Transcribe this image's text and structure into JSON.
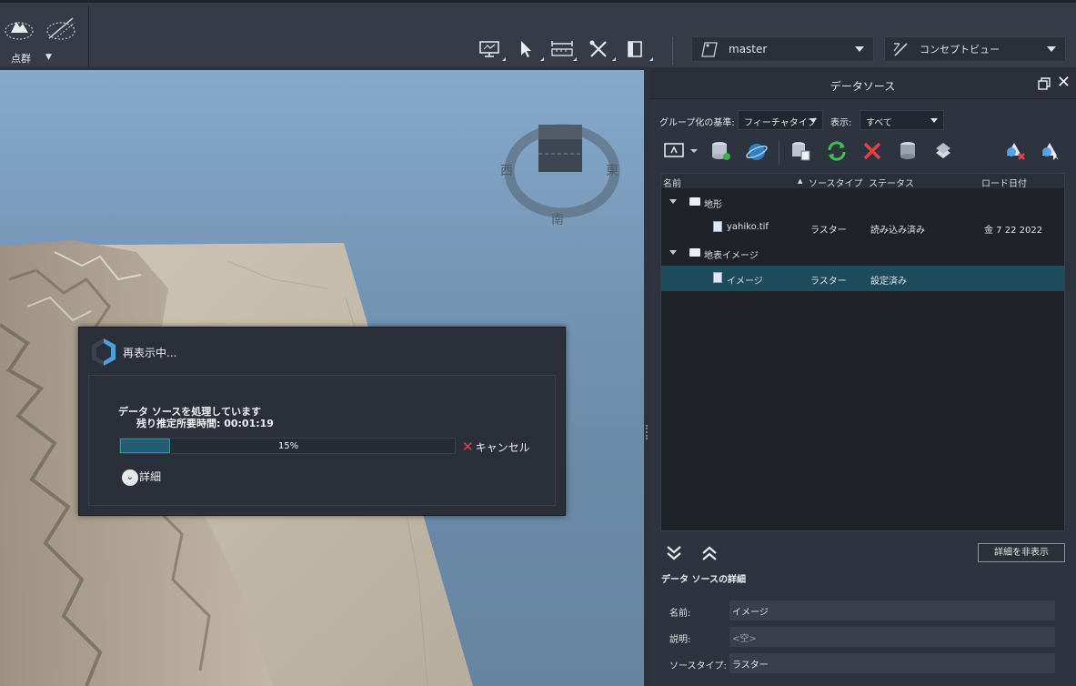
{
  "toolbar": {
    "group_label": "点群",
    "branch": "master",
    "view": "コンセプトビュー"
  },
  "compass": {
    "west": "西",
    "east": "東",
    "south": "南"
  },
  "panel": {
    "title": "データソース",
    "group_by_label": "グループ化の基準:",
    "group_by_value": "フィーチャタイプ",
    "display_label": "表示:",
    "display_value": "すべて",
    "columns": [
      "名前",
      "ソースタイプ",
      "ステータス",
      "ロード日付"
    ],
    "rows": [
      {
        "type": "folder",
        "name": "地形"
      },
      {
        "type": "file",
        "name": "yahiko.tif",
        "source": "ラスター",
        "status": "読み込み済み",
        "date": "金 7 22 2022"
      },
      {
        "type": "folder",
        "name": "地表イメージ"
      },
      {
        "type": "file",
        "name": "イメージ",
        "source": "ラスター",
        "status": "設定済み",
        "date": "",
        "selected": true
      }
    ],
    "hide_details": "詳細を非表示",
    "details_title": "データ ソースの詳細",
    "details": [
      {
        "label": "名前:",
        "value": "イメージ"
      },
      {
        "label": "説明:",
        "value": "<空>"
      },
      {
        "label": "ソースタイプ:",
        "value": "ラスター"
      }
    ]
  },
  "dialog": {
    "title": "再表示中...",
    "message": "データ ソースを処理しています",
    "remaining": "残り推定所要時間: 00:01:19",
    "progress": 15,
    "progress_text": "15%",
    "cancel": "キャンセル",
    "details": "詳細"
  },
  "colors": {
    "selection": "#1f4c5d",
    "progress_fill": "#1f5f76",
    "cancel_x": "#e0474c"
  }
}
